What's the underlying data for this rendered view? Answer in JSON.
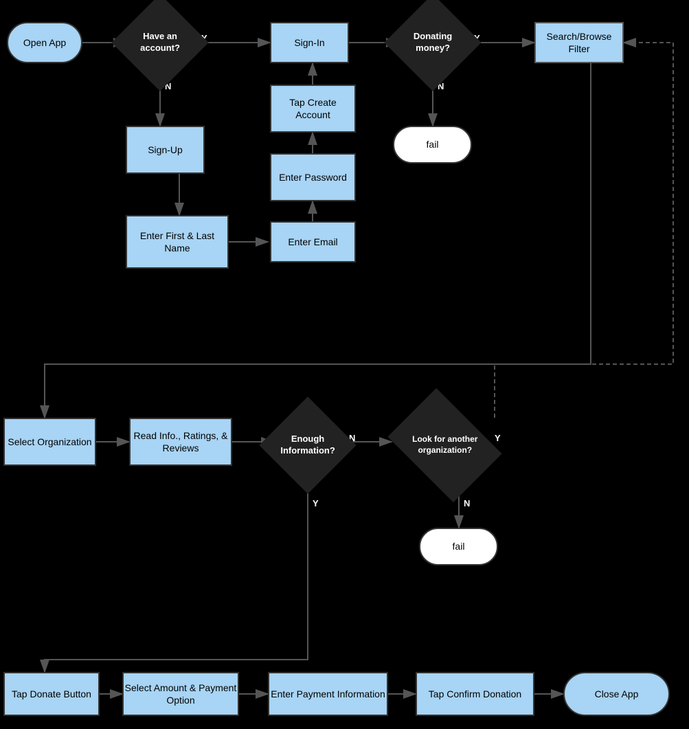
{
  "nodes": {
    "open_app": {
      "label": "Open App"
    },
    "have_account": {
      "label": "Have an account?"
    },
    "sign_in": {
      "label": "Sign-In"
    },
    "donating_money": {
      "label": "Donating money?"
    },
    "search_browse": {
      "label": "Search/Browse Filter"
    },
    "sign_up": {
      "label": "Sign-Up"
    },
    "enter_name": {
      "label": "Enter First & Last Name"
    },
    "tap_create": {
      "label": "Tap Create Account"
    },
    "enter_password": {
      "label": "Enter Password"
    },
    "enter_email": {
      "label": "Enter Email"
    },
    "fail1": {
      "label": "fail"
    },
    "select_org": {
      "label": "Select Organization"
    },
    "read_info": {
      "label": "Read Info., Ratings, & Reviews"
    },
    "enough_info": {
      "label": "Enough Information?"
    },
    "look_another": {
      "label": "Look for another organization?"
    },
    "fail2": {
      "label": "fail"
    },
    "tap_donate": {
      "label": "Tap Donate Button"
    },
    "select_amount": {
      "label": "Select Amount & Payment Option"
    },
    "enter_payment": {
      "label": "Enter Payment Information"
    },
    "tap_confirm": {
      "label": "Tap Confirm Donation"
    },
    "close_app": {
      "label": "Close App"
    }
  },
  "edge_labels": {
    "y": "Y",
    "n": "N"
  }
}
